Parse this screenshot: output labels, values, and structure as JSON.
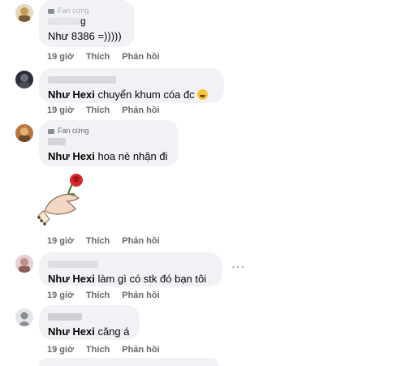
{
  "comments": [
    {
      "badge": "Fan cứng",
      "author_tail": "g",
      "text": "Như 8386 =)))))",
      "time": "19 giờ",
      "like": "Thích",
      "reply": "Phản hồi"
    },
    {
      "mention": "Như Hexi",
      "text": " chuyển khum cóa đc",
      "time": "19 giờ",
      "like": "Thích",
      "reply": "Phản hồi"
    },
    {
      "badge": "Fan cứng",
      "mention": "Như Hexi",
      "text": " hoa nè nhận đi",
      "time": "19 giờ",
      "like": "Thích",
      "reply": "Phản hồi"
    },
    {
      "mention": "Như Hexi",
      "text": " làm gì có stk đó bạn tôi",
      "more": "···",
      "time": "19 giờ",
      "like": "Thích",
      "reply": "Phản hồi"
    },
    {
      "mention": "Như Hexi",
      "text": " căng á",
      "time": "19 giờ",
      "like": "Thích",
      "reply": "Phản hồi"
    }
  ],
  "icons": {
    "badge": "fan-badge-icon",
    "emoji": "laughing-tears-emoji-icon",
    "sticker": "hand-holding-rose-sticker",
    "more": "more-options-icon"
  }
}
